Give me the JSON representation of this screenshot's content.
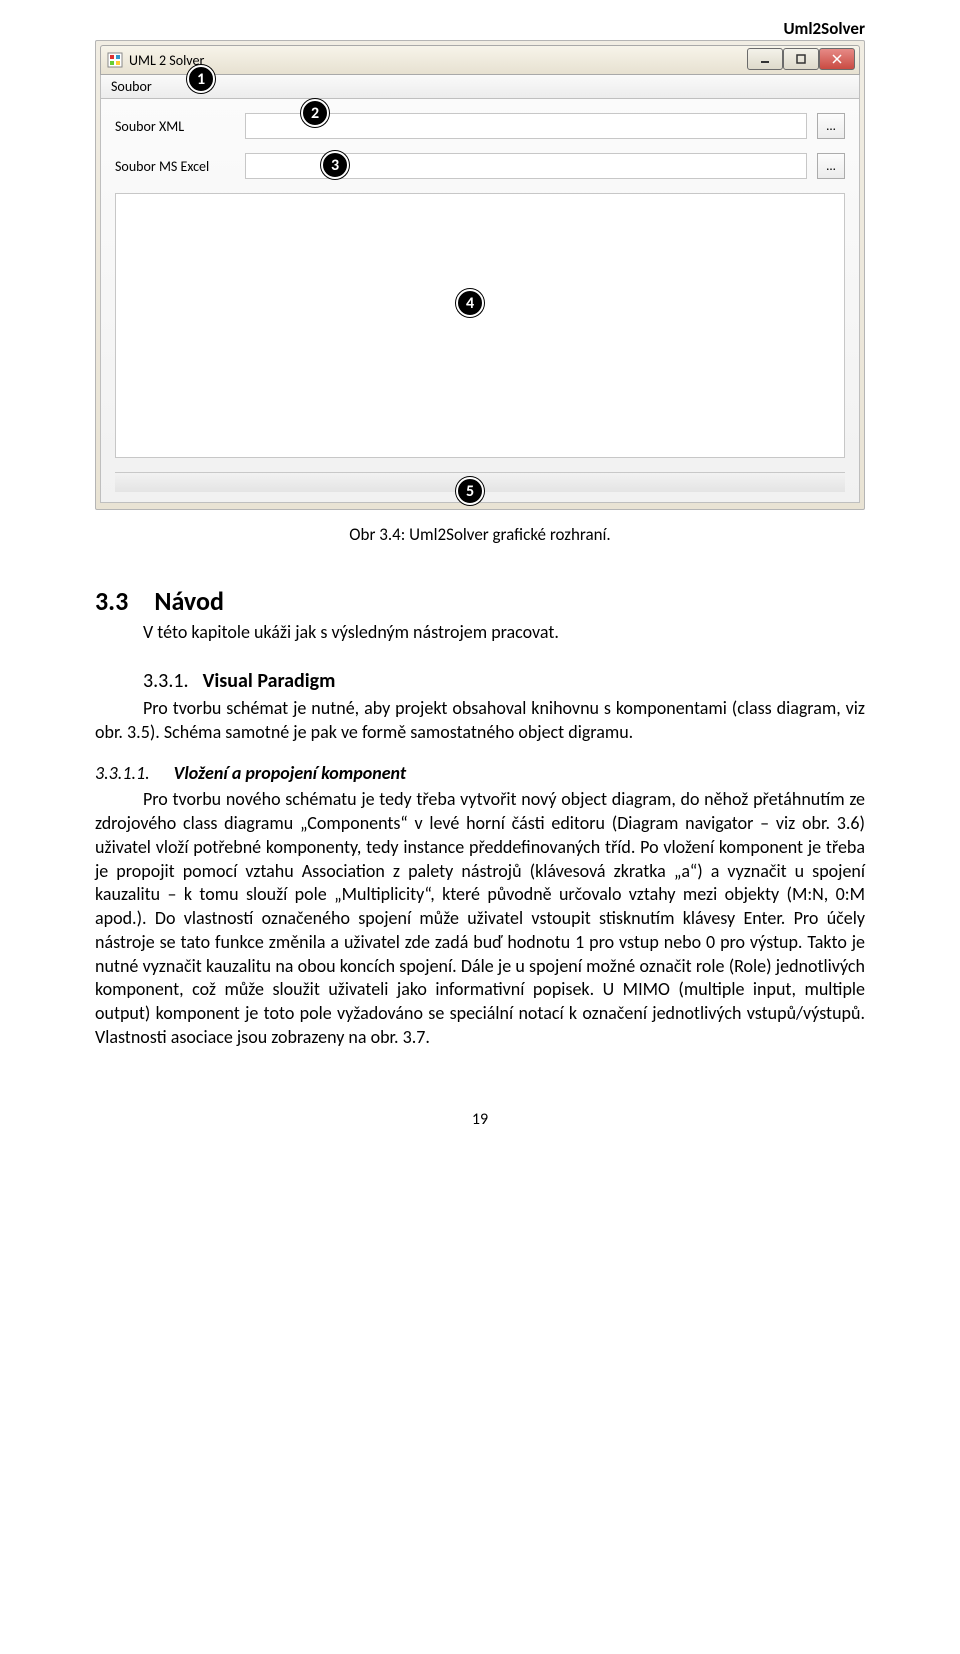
{
  "header": {
    "right": "Uml2Solver"
  },
  "screenshot": {
    "title": "UML 2 Solver",
    "menu": {
      "soubor": "Soubor"
    },
    "rows": {
      "xml_label": "Soubor XML",
      "xls_label": "Soubor MS Excel",
      "browse": "..."
    },
    "callouts": {
      "c1": "1",
      "c2": "2",
      "c3": "3",
      "c4": "4",
      "c5": "5"
    }
  },
  "caption": "Obr 3.4: Uml2Solver grafické rozhraní.",
  "sections": {
    "s33": {
      "num": "3.3",
      "title": "Návod"
    },
    "s33_body": "V této kapitole ukáži jak s výsledným nástrojem pracovat.",
    "s331": {
      "num": "3.3.1.",
      "title": "Visual Paradigm"
    },
    "s331_body": "Pro tvorbu schémat je nutné, aby projekt obsahoval knihovnu s komponentami (class diagram, viz obr. 3.5). Schéma samotné je pak ve formě samostatného object digramu.",
    "s3311": {
      "num": "3.3.1.1.",
      "title": "Vložení a propojení komponent"
    },
    "s3311_body": "Pro tvorbu nového schématu je tedy třeba vytvořit nový object diagram, do něhož přetáhnutím ze zdrojového class diagramu „Components“ v levé horní části editoru (Diagram navigator – viz obr. 3.6) uživatel vloží potřebné komponenty, tedy instance předdefinovaných tříd. Po vložení komponent je třeba je propojit pomocí vztahu Association z palety nástrojů (klávesová zkratka „a“) a vyznačit u spojení kauzalitu – k tomu slouží pole „Multiplicity“, které původně určovalo vztahy mezi objekty (M:N, 0:M apod.). Do vlastností označeného spojení může uživatel vstoupit stisknutím klávesy Enter. Pro účely nástroje se tato funkce změnila a uživatel zde zadá buď hodnotu 1 pro vstup nebo 0 pro výstup. Takto je nutné vyznačit kauzalitu na obou koncích spojení. Dále je u spojení možné označit role (Role) jednotlivých komponent, což může sloužit uživateli jako informativní popisek. U MIMO (multiple input, multiple output) komponent je toto pole vyžadováno se speciální notací k označení jednotlivých vstupů/výstupů. Vlastnosti asociace jsou zobrazeny na obr. 3.7."
  },
  "page_number": "19"
}
